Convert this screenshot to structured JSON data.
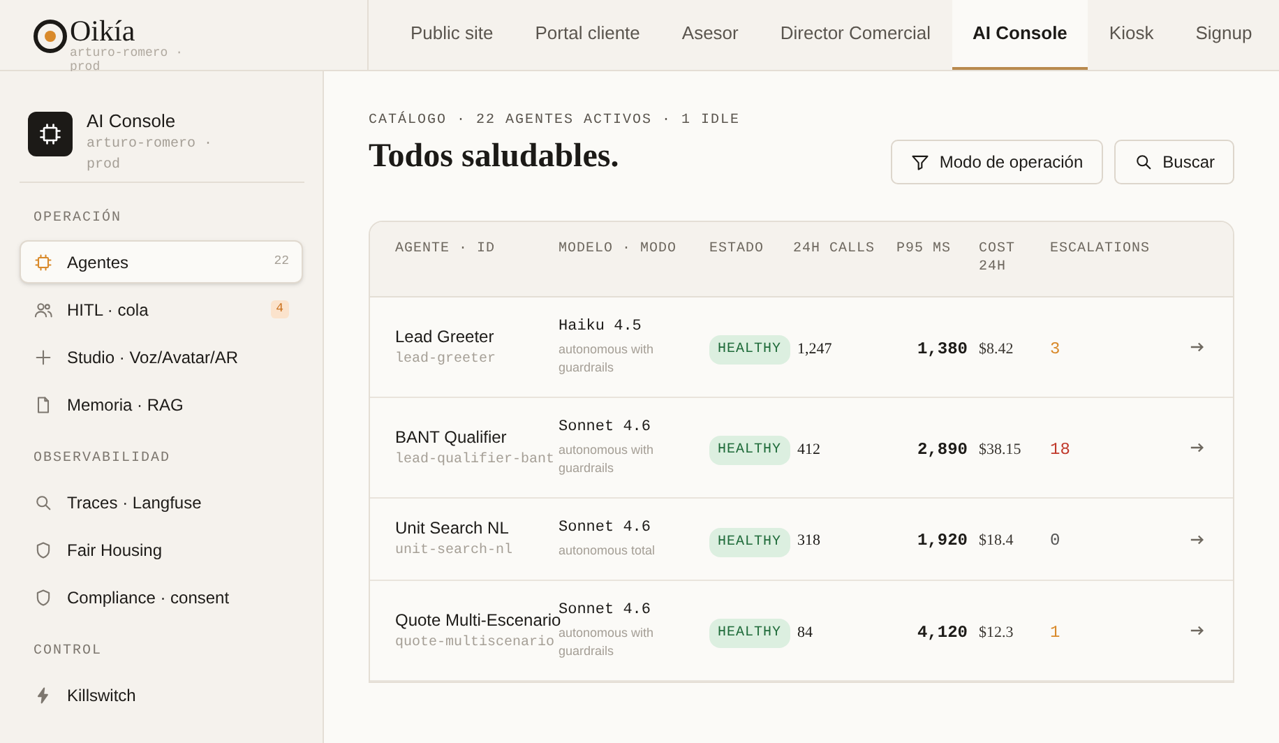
{
  "brand": {
    "name": "Oikía",
    "subtitle": "arturo-romero · prod"
  },
  "nav_tabs": [
    {
      "label": "Public site",
      "selected": false
    },
    {
      "label": "Portal cliente",
      "selected": false
    },
    {
      "label": "Asesor",
      "selected": false
    },
    {
      "label": "Director Comercial",
      "selected": false
    },
    {
      "label": "AI Console",
      "selected": true
    },
    {
      "label": "Kiosk",
      "selected": false
    },
    {
      "label": "Signup",
      "selected": false
    }
  ],
  "sidebar": {
    "title": "AI Console",
    "subtitle": "arturo-romero · prod",
    "sections": [
      {
        "heading": "OPERACIÓN",
        "items": [
          {
            "label": "Agentes",
            "kind": "counted",
            "count": "22",
            "selected": true
          },
          {
            "label": "HITL · cola",
            "kind": "alert",
            "count": "4",
            "selected": false
          },
          {
            "label": "Studio · Voz/Avatar/AR",
            "kind": "plain",
            "selected": false
          },
          {
            "label": "Memoria · RAG",
            "kind": "plain",
            "selected": false
          }
        ]
      },
      {
        "heading": "OBSERVABILIDAD",
        "items": [
          {
            "label": "Traces · Langfuse",
            "kind": "plain",
            "selected": false
          },
          {
            "label": "Fair Housing",
            "kind": "plain",
            "selected": false
          },
          {
            "label": "Compliance · consent",
            "kind": "plain",
            "selected": false
          }
        ]
      },
      {
        "heading": "CONTROL",
        "items": [
          {
            "label": "Killswitch",
            "kind": "plain",
            "selected": false
          }
        ]
      }
    ]
  },
  "main": {
    "eyebrow": "CATÁLOGO · 22 AGENTES ACTIVOS · 1 IDLE",
    "title": "Todos saludables.",
    "buttons": [
      "Modo de operación",
      "Buscar"
    ]
  },
  "table": {
    "columns": [
      "AGENTE · ID",
      "MODELO · MODO",
      "ESTADO",
      "24H CALLS",
      "P95 MS",
      "COST 24H",
      "ESCALATIONS"
    ],
    "rows": [
      {
        "name": "Lead Greeter",
        "id": "lead-greeter",
        "model": "Haiku 4.5",
        "mode": "autonomous with guardrails",
        "status": "HEALTHY",
        "calls": "1,247",
        "p95": "1,380",
        "cost": "$8.42",
        "escalations": "3",
        "color": "#d98a2b"
      },
      {
        "name": "BANT Qualifier",
        "id": "lead-qualifier-bant",
        "model": "Sonnet 4.6",
        "mode": "autonomous with guardrails",
        "status": "HEALTHY",
        "calls": "412",
        "p95": "2,890",
        "cost": "$38.15",
        "escalations": "18",
        "color": "#c0392b"
      },
      {
        "name": "Unit Search NL",
        "id": "unit-search-nl",
        "model": "Sonnet 4.6",
        "mode": "autonomous total",
        "status": "HEALTHY",
        "calls": "318",
        "p95": "1,920",
        "cost": "$18.4",
        "escalations": "0",
        "color": "#555555"
      },
      {
        "name": "Quote Multi-Escenario",
        "id": "quote-multiscenario",
        "model": "Sonnet 4.6",
        "mode": "autonomous with guardrails",
        "status": "HEALTHY",
        "calls": "84",
        "p95": "4,120",
        "cost": "$12.3",
        "escalations": "1",
        "color": "#d98a2b"
      }
    ]
  }
}
